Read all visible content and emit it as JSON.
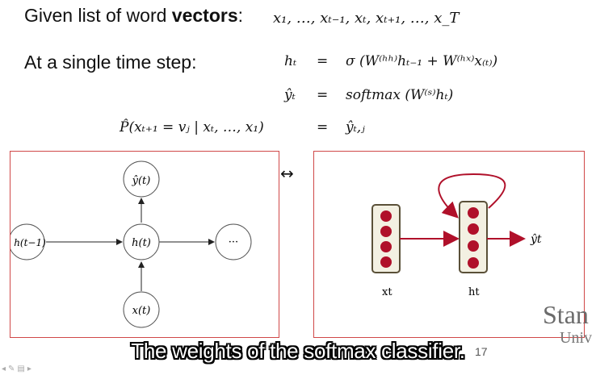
{
  "slide": {
    "line1_text": "Given list of word ",
    "line1_bold": "vectors",
    "line1_colon": ":",
    "line1_math": "x₁, …, xₜ₋₁, xₜ, xₜ₊₁, …, x_T",
    "line2_text": "At a single time step:",
    "eq1_lhs": "hₜ",
    "eq1_eq": "=",
    "eq1_rhs": "σ (W⁽ʰʰ⁾hₜ₋₁ + W⁽ʰˣ⁾x₍ₜ₎)",
    "eq2_lhs": "ŷₜ",
    "eq2_eq": "=",
    "eq2_rhs": "softmax (W⁽ˢ⁾hₜ)",
    "eq3_lhs": "P̂(xₜ₊₁ = vⱼ | xₜ, …, x₁)",
    "eq3_eq": "=",
    "eq3_rhs": "ŷₜ,ⱼ",
    "arrow_between": "↔"
  },
  "left_diagram": {
    "node_y": "ŷ(t)",
    "node_h_prev": "h(t−1)",
    "node_h": "h(t)",
    "node_next": "···",
    "node_x": "x(t)"
  },
  "right_diagram": {
    "label_x": "xt",
    "label_h": "ht",
    "label_y": "ŷt",
    "colors": {
      "neuron": "#b0102a",
      "arrow": "#b0102a",
      "box_border": "#5a5038"
    }
  },
  "logo": {
    "line1": "Stan",
    "line2": "Univ"
  },
  "slide_number": "17",
  "caption": "The weights of the softmax classifier.",
  "toolbar": {
    "icons": [
      "prev-icon",
      "pen-icon",
      "menu-icon",
      "next-icon"
    ]
  }
}
